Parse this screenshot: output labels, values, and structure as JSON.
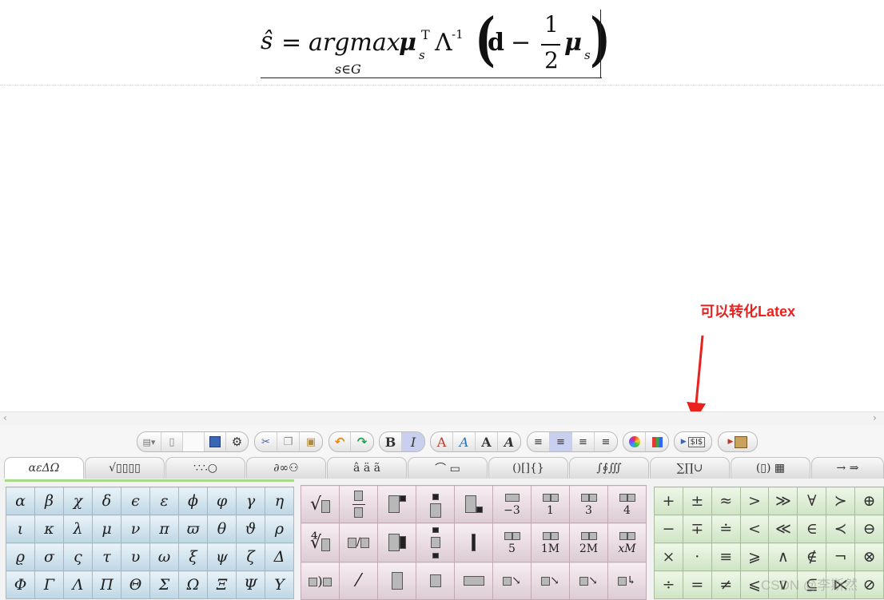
{
  "formula": {
    "hat_s": "ŝ",
    "equals": "=",
    "argmax": "argmax",
    "mu": "μ",
    "sub_s": "s",
    "sup_T": "T",
    "lambda": "Λ",
    "sup_inv": "-1",
    "lparen": "(",
    "d": "d",
    "minus": "−",
    "frac_num": "1",
    "frac_den": "2",
    "mu2": "μ",
    "sub_s2": "s",
    "rparen": ")",
    "under": "s∈G"
  },
  "annotation": {
    "text": "可以转化Latex"
  },
  "scrollbar": {
    "left_arrow": "‹",
    "right_arrow": "›"
  },
  "toolbar": {
    "format_label": "▤▾",
    "new_label": "▯",
    "bold": "B",
    "italic": "I",
    "font_a1": "A",
    "font_a2": "A",
    "font_a3": "A",
    "font_a4": "A",
    "align_left": "≡",
    "align_center": "≡",
    "align_right": "≡",
    "align_justify": "≡",
    "latex_label": "$I$"
  },
  "tabs": [
    {
      "label": "αεΔΩ"
    },
    {
      "label": "√▯▯▯▯"
    },
    {
      "label": "∵∴○"
    },
    {
      "label": "∂∞⚇"
    },
    {
      "label": "â ä ã"
    },
    {
      "label": "⌒ ▭"
    },
    {
      "label": "()[]{}"
    },
    {
      "label": "∫∮∭"
    },
    {
      "label": "∑∏∪"
    },
    {
      "label": "(▯) ▦"
    },
    {
      "label": "→ ⇒"
    }
  ],
  "greek_rows": [
    [
      "α",
      "β",
      "χ",
      "δ",
      "ϵ",
      "ε",
      "ϕ",
      "φ",
      "γ",
      "η"
    ],
    [
      "ι",
      "κ",
      "λ",
      "μ",
      "ν",
      "π",
      "ϖ",
      "θ",
      "ϑ",
      "ρ"
    ],
    [
      "ϱ",
      "σ",
      "ς",
      "τ",
      "υ",
      "ω",
      "ξ",
      "ψ",
      "ζ",
      "Δ"
    ],
    [
      "Φ",
      "Γ",
      "Λ",
      "Π",
      "Θ",
      "Σ",
      "Ω",
      "Ξ",
      "Ψ",
      "Υ"
    ]
  ],
  "template_labels": {
    "r1c7": "−3",
    "r1c8": "1",
    "r1c9": "3",
    "r1c10": "4",
    "r2c7": "5",
    "r2c8": "1M",
    "r2c9": "2M",
    "r2c10": "xM"
  },
  "ops_rows": [
    [
      "+",
      "±",
      "≈",
      ">",
      "≫",
      "∀",
      "≻",
      "⊕"
    ],
    [
      "−",
      "∓",
      "≐",
      "<",
      "≪",
      "∈",
      "≺",
      "⊖"
    ],
    [
      "×",
      "·",
      "≡",
      "⩾",
      "∧",
      "∉",
      "¬",
      "⊗"
    ],
    [
      "÷",
      "=",
      "≠",
      "⩽",
      "∨",
      "⊆",
      "⋉",
      "⊘"
    ]
  ],
  "watermark": "CSDN @李斯然"
}
